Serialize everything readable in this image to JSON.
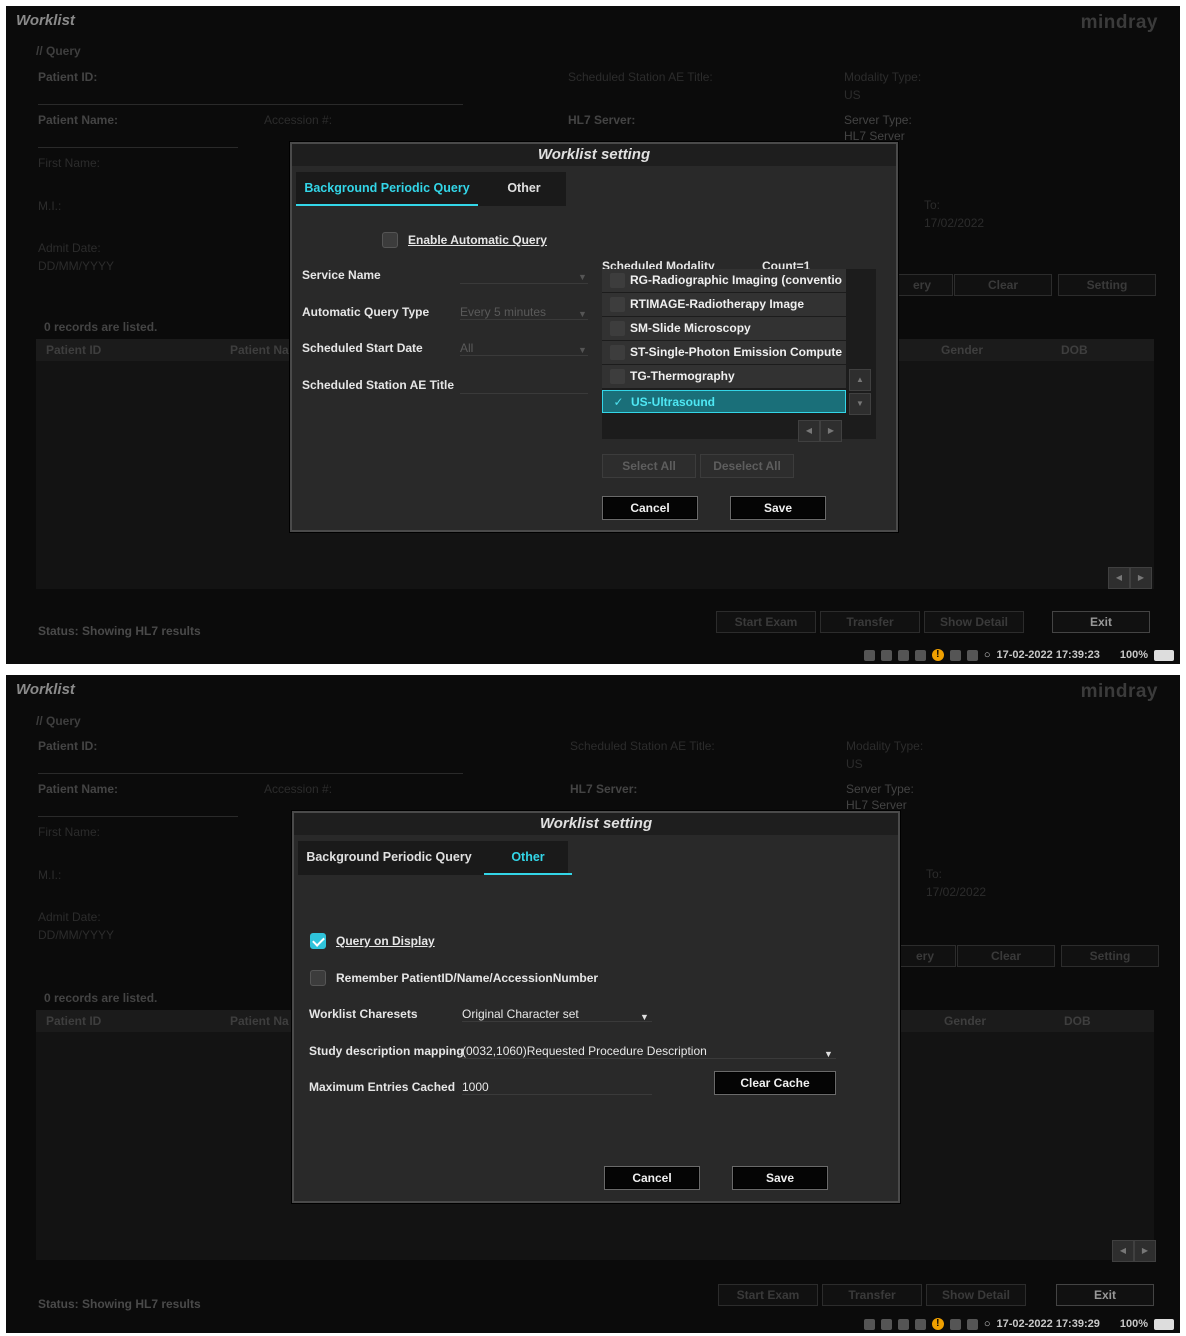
{
  "background": {
    "app_title": "Worklist",
    "brand": "mindray",
    "section": "// Query",
    "patient_id": "Patient ID:",
    "patient_name": "Patient Name:",
    "accession": "Accession #:",
    "first_name": "First Name:",
    "mi": "M.I.:",
    "admit_date": "Admit Date:",
    "admit_placeholder": "DD/MM/YYYY",
    "sched_station": "Scheduled Station AE Title:",
    "modality_type": "Modality Type:",
    "modality_value": "US",
    "hl7_server": "HL7 Server:",
    "server_type": "Server Type:",
    "server_type_value": "HL7 Server",
    "to": "To:",
    "to_value": "17/02/2022",
    "query_btn": "ery",
    "clear_btn": "Clear",
    "setting_btn": "Setting",
    "records": "0 records are listed.",
    "col_patient_id": "Patient ID",
    "col_patient_name": "Patient Na",
    "col_gender": "Gender",
    "col_dob": "DOB",
    "start_exam": "Start Exam",
    "transfer": "Transfer",
    "show_detail": "Show Detail",
    "exit": "Exit",
    "status": "Status: Showing HL7 results",
    "battery": "100%"
  },
  "screen1": {
    "datetime": "17-02-2022 17:39:23",
    "dialog": {
      "title": "Worklist setting",
      "tab_bg": "Background Periodic Query",
      "tab_other": "Other",
      "enable_auto": "Enable Automatic Query",
      "service_name": "Service Name",
      "auto_query_type": "Automatic Query Type",
      "auto_query_value": "Every 5 minutes",
      "sched_start": "Scheduled Start Date",
      "sched_start_value": "All",
      "sched_station": "Scheduled Station AE Title",
      "sched_modality": "Scheduled Modality",
      "count": "Count=1",
      "modalities": [
        "RG-Radiographic Imaging (conventio",
        "RTIMAGE-Radiotherapy Image",
        "SM-Slide Microscopy",
        "ST-Single-Photon Emission Compute",
        "TG-Thermography",
        "US-Ultrasound"
      ],
      "select_all": "Select All",
      "deselect_all": "Deselect All",
      "cancel": "Cancel",
      "save": "Save"
    }
  },
  "screen2": {
    "datetime": "17-02-2022 17:39:29",
    "dialog": {
      "title": "Worklist setting",
      "tab_bg": "Background Periodic Query",
      "tab_other": "Other",
      "query_on_display": "Query on Display",
      "remember": "Remember PatientID/Name/AccessionNumber",
      "charsets_label": "Worklist Charesets",
      "charsets_value": "Original Character set",
      "mapping_label": "Study description mapping",
      "mapping_value": "(0032,1060)Requested Procedure Description",
      "max_label": "Maximum Entries Cached",
      "max_value": "1000",
      "clear_cache": "Clear Cache",
      "cancel": "Cancel",
      "save": "Save"
    }
  }
}
